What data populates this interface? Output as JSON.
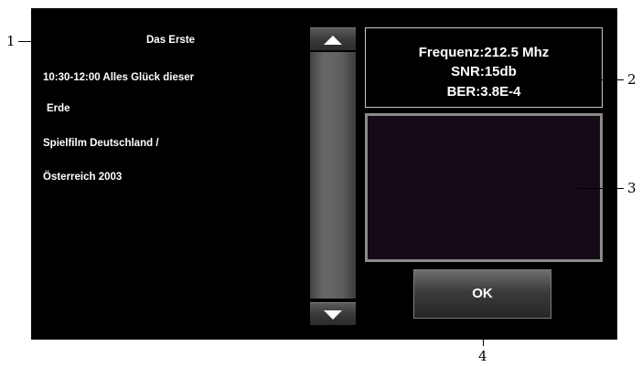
{
  "channel": {
    "name": "Das Erste",
    "lines": [
      "10:30-12:00 Alles Glück dieser",
      "Erde",
      "Spielfilm Deutschland /",
      "Österreich 2003"
    ]
  },
  "signal": {
    "frequency": "Frequenz:212.5 Mhz",
    "snr": "SNR:15db",
    "ber": "BER:3.8E-4"
  },
  "buttons": {
    "ok_label": "OK"
  },
  "icons": {
    "scroll_up": "triangle-up-icon",
    "scroll_down": "triangle-down-icon"
  },
  "callouts": [
    "1",
    "2",
    "3",
    "4"
  ],
  "colors": {
    "background": "#000000",
    "text": "#ffffff",
    "preview": "#150a15",
    "border": "#8a8a8a"
  }
}
